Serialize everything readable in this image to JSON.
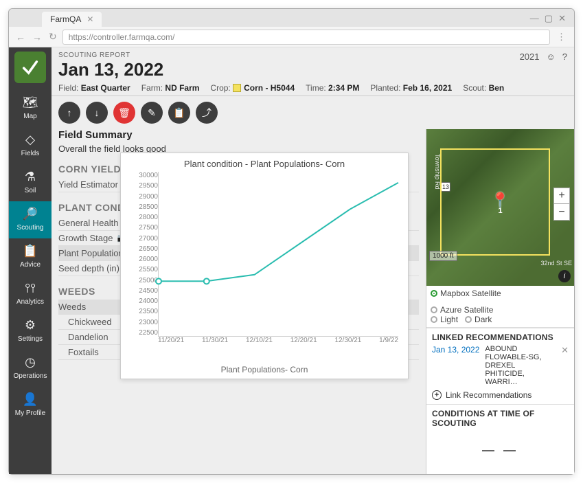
{
  "browser": {
    "tab_title": "FarmQA",
    "url": "https://controller.farmqa.com/"
  },
  "sidebar": {
    "items": [
      {
        "name": "map",
        "label": "Map"
      },
      {
        "name": "fields",
        "label": "Fields"
      },
      {
        "name": "soil",
        "label": "Soil"
      },
      {
        "name": "scouting",
        "label": "Scouting"
      },
      {
        "name": "advice",
        "label": "Advice"
      },
      {
        "name": "analytics",
        "label": "Analytics"
      },
      {
        "name": "settings",
        "label": "Settings"
      },
      {
        "name": "operations",
        "label": "Operations"
      },
      {
        "name": "my-profile",
        "label": "My Profile"
      }
    ]
  },
  "header": {
    "label": "SCOUTING REPORT",
    "title": "Jan 13, 2022",
    "year": "2021",
    "meta": {
      "field_label": "Field:",
      "field_value": "East Quarter",
      "farm_label": "Farm:",
      "farm_value": "ND Farm",
      "crop_label": "Crop:",
      "crop_value": "Corn - H5044",
      "time_label": "Time:",
      "time_value": "2:34 PM",
      "planted_label": "Planted:",
      "planted_value": "Feb 16, 2021",
      "scout_label": "Scout:",
      "scout_value": "Ben"
    }
  },
  "actions": [
    "up",
    "down",
    "delete",
    "edit",
    "clipboard",
    "share"
  ],
  "field_summary": {
    "title": "Field Summary",
    "text": "Overall the field looks good"
  },
  "categories": [
    {
      "heading": "CORN YIELD",
      "items": [
        {
          "label": "Yield Estimator",
          "icons": []
        }
      ]
    },
    {
      "heading": "PLANT CONDITION",
      "items": [
        {
          "label": "General Health"
        },
        {
          "label": "Growth Stage",
          "icons": [
            "camera",
            "note"
          ]
        },
        {
          "label": "Plant Populations",
          "icons": [
            "camera",
            "note"
          ],
          "selected": true
        },
        {
          "label": "Seed depth (in)",
          "icons": [
            "camera",
            "note"
          ]
        }
      ]
    },
    {
      "heading": "WEEDS",
      "items": [
        {
          "label": "Weeds",
          "selected": true
        },
        {
          "label": "Chickweed",
          "indent": true
        },
        {
          "label": "Dandelion",
          "indent": true
        },
        {
          "label": "Foxtails",
          "indent": true
        }
      ]
    }
  ],
  "chart_data": {
    "type": "line",
    "title": "Plant condition - Plant Populations- Corn",
    "xlabel": "Plant Populations- Corn",
    "ylabel": "",
    "ylim": [
      22500,
      30000
    ],
    "ystep": 500,
    "categories": [
      "11/20/21",
      "11/30/21",
      "12/10/21",
      "12/20/21",
      "12/30/21",
      "1/9/22"
    ],
    "values": [
      25000,
      25000,
      25300,
      26800,
      28300,
      29500
    ],
    "markers_at_indices": [
      0,
      1
    ],
    "line_color": "#2bbdb0"
  },
  "map": {
    "zoom_in": "+",
    "zoom_out": "−",
    "scale_label": "1000 ft",
    "pin_label": "1",
    "road1": "Township Rd",
    "road2": "32nd St SE",
    "hwy": "13",
    "layers": {
      "mapbox_sat": "Mapbox Satellite",
      "azure_sat": "Azure Satellite",
      "light": "Light",
      "dark": "Dark"
    }
  },
  "linked_rec": {
    "title": "LINKED RECOMMENDATIONS",
    "date": "Jan 13, 2022",
    "text": "ABOUND FLOWABLE-SG, DREXEL PHITICIDE, WARRI…",
    "link_label": "Link Recommendations"
  },
  "conditions": {
    "title": "CONDITIONS AT TIME OF SCOUTING",
    "placeholder": "— —"
  }
}
